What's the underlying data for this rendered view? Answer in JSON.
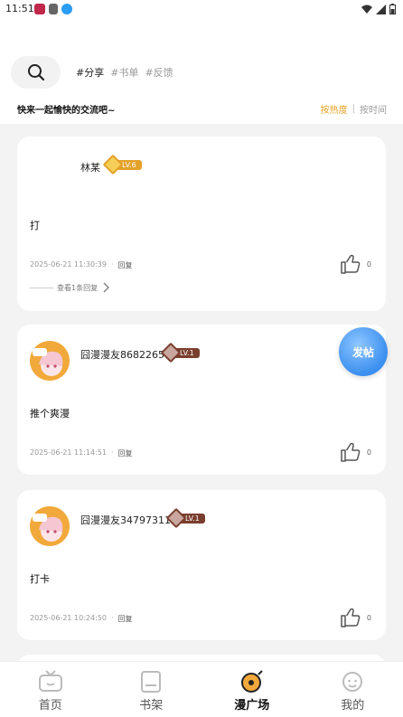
{
  "status_bar": {
    "time": "11:51"
  },
  "header": {
    "tags": [
      "#分享",
      "#书单",
      "#反馈"
    ],
    "subtitle": "快来一起愉快的交流吧~",
    "sort": {
      "hot": "按热度",
      "time": "按时间"
    }
  },
  "posts": [
    {
      "username": "林某",
      "level": "LV.6",
      "content": "打",
      "timestamp": "2025-06-21 11:30:39",
      "reply_label": "回复",
      "likes": "0",
      "replies_text": "查看1条回复"
    },
    {
      "username": "囧漫漫友8682265",
      "level": "LV.1",
      "content": "推个爽漫",
      "timestamp": "2025-06-21 11:14:51",
      "reply_label": "回复",
      "likes": "0"
    },
    {
      "username": "囧漫漫友34797311",
      "level": "LV.1",
      "content": "打卡",
      "timestamp": "2025-06-21 10:24:50",
      "reply_label": "回复",
      "likes": "0"
    }
  ],
  "float_button": {
    "label": "发帖"
  },
  "tabbar": [
    {
      "label": "首页",
      "icon": "tv-icon"
    },
    {
      "label": "书架",
      "icon": "bookshelf-icon"
    },
    {
      "label": "漫广场",
      "icon": "plaza-icon"
    },
    {
      "label": "我的",
      "icon": "profile-icon"
    }
  ],
  "colors": {
    "accent": "#e8a021",
    "lv6": "#e3a12a",
    "lv1": "#7a3e2e"
  }
}
